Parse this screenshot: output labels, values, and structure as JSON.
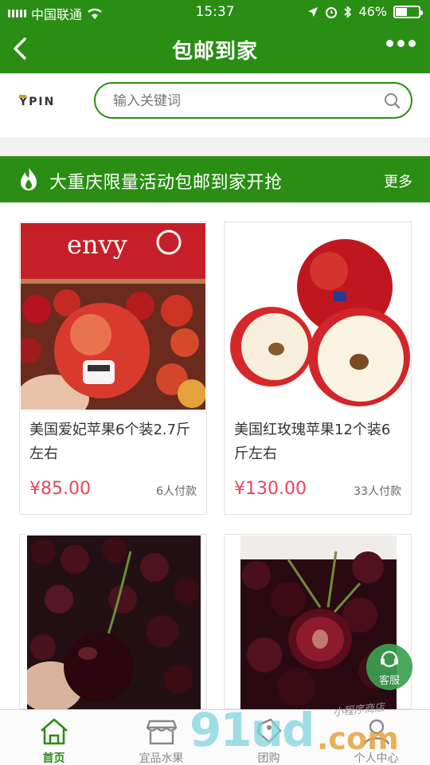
{
  "status_bar": {
    "carrier": "中国联通",
    "time": "15:37",
    "battery": "46%"
  },
  "nav": {
    "title": "包邮到家"
  },
  "search": {
    "logo_text": "YPIN",
    "placeholder": "输入关键词"
  },
  "banner": {
    "title": "大重庆限量活动包邮到家开抢",
    "more_label": "更多"
  },
  "products": [
    {
      "name": "美国爱妃苹果6个装2.7斤左右",
      "price": "¥85.00",
      "sold": "6人付款",
      "image": "envy-apple-box-photo",
      "label_text": "envy"
    },
    {
      "name": "美国红玫瑰苹果12个装6斤左右",
      "price": "¥130.00",
      "sold": "33人付款",
      "image": "red-apple-halves-photo"
    },
    {
      "name": "",
      "price": "",
      "sold": "",
      "image": "dark-cherries-in-hand-photo"
    },
    {
      "name": "",
      "price": "",
      "sold": "",
      "image": "cherry-halved-photo"
    }
  ],
  "service": {
    "label": "客服"
  },
  "tabbar": {
    "tabs": [
      {
        "label": "首页",
        "icon": "home-icon",
        "active": true
      },
      {
        "label": "宜品水果",
        "icon": "store-icon",
        "active": false
      },
      {
        "label": "团购",
        "icon": "group-buy-icon",
        "active": false
      },
      {
        "label": "个人中心",
        "icon": "user-icon",
        "active": false
      }
    ]
  },
  "watermark": {
    "brand": "91ud",
    "domain": ".com",
    "caption": "小程序商店"
  },
  "colors": {
    "brand_green": "#2a8e14",
    "price_red": "#e8455b"
  }
}
